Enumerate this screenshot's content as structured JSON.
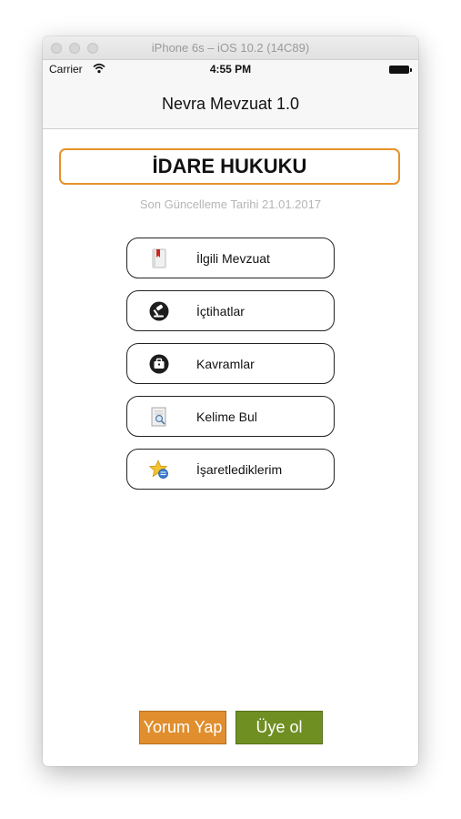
{
  "window": {
    "title": "iPhone 6s – iOS 10.2 (14C89)"
  },
  "status_bar": {
    "carrier": "Carrier",
    "time": "4:55 PM"
  },
  "nav": {
    "title": "Nevra Mevzuat 1.0"
  },
  "header": {
    "title": "İDARE HUKUKU",
    "update_text": "Son Güncelleme Tarihi 21.01.2017"
  },
  "menu": [
    {
      "label": "İlgili Mevzuat",
      "icon": "book-icon"
    },
    {
      "label": "İçtihatlar",
      "icon": "gavel-icon"
    },
    {
      "label": "Kavramlar",
      "icon": "briefcase-icon"
    },
    {
      "label": "Kelime Bul",
      "icon": "search-document-icon"
    },
    {
      "label": "İşaretlediklerim",
      "icon": "star-bookmark-icon"
    }
  ],
  "buttons": {
    "comment": "Yorum Yap",
    "register": "Üye ol"
  },
  "colors": {
    "title_border": "#e6922b",
    "comment_button": "#e08e2e",
    "register_button": "#6f8f23",
    "update_text": "#b5b5b5"
  }
}
